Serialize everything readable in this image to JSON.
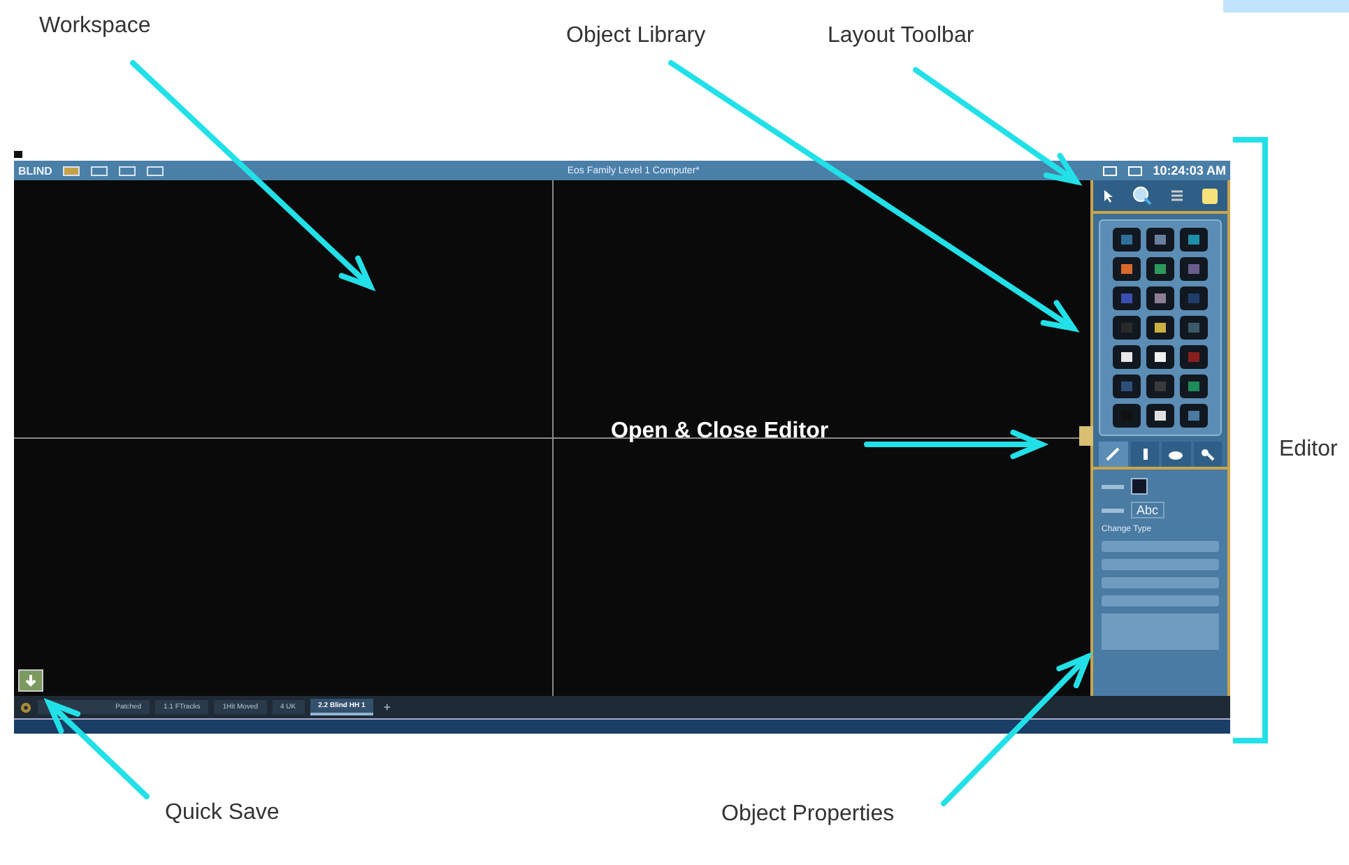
{
  "annotations": [
    {
      "kind": "label",
      "text": "Workspace"
    },
    {
      "kind": "label",
      "text": "Object Library"
    },
    {
      "kind": "label",
      "text": "Layout Toolbar"
    },
    {
      "kind": "callout",
      "text": "Open & Close Editor"
    },
    {
      "kind": "label",
      "text": "Editor"
    },
    {
      "kind": "label",
      "text": "Quick Save"
    },
    {
      "kind": "label",
      "text": "Object Properties"
    }
  ],
  "title_bar": {
    "mode": "BLIND",
    "title": "Eos Family Level 1 Computer*",
    "time": "10:24:03 AM"
  },
  "editor": {
    "tool_tabs": [
      {
        "selected": true
      },
      {
        "selected": false
      },
      {
        "selected": false
      },
      {
        "selected": false
      }
    ],
    "properties": {
      "font_sample": "Abc",
      "section": "Change Type"
    }
  },
  "workspace_tabs": [
    {
      "label": "Patched",
      "selected": false
    },
    {
      "label": "1.1 FTracks",
      "selected": false
    },
    {
      "label": "1Hit Moved",
      "selected": false
    },
    {
      "label": "4 UK",
      "selected": false
    },
    {
      "label": "2.2 Blind HH 1",
      "selected": true
    }
  ],
  "add_tab": "+"
}
